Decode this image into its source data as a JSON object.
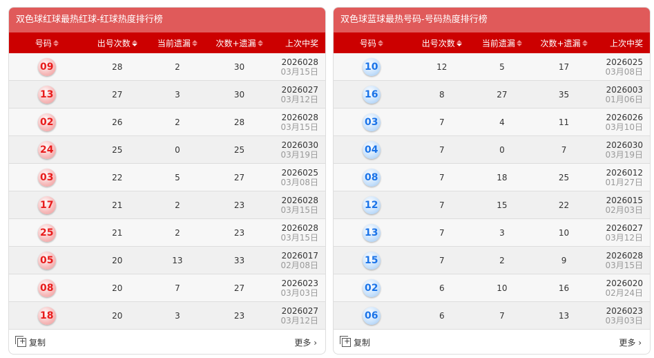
{
  "columns": [
    "号码",
    "出号次数",
    "当前遗漏",
    "次数+遗漏",
    "上次中奖"
  ],
  "footer": {
    "copy": "复制",
    "more": "更多 ›"
  },
  "panels": [
    {
      "title": "双色球红球最热红球-红球热度排行榜",
      "ball": "red",
      "rows": [
        [
          "09",
          "28",
          "2",
          "30",
          "2026028",
          "03月15日"
        ],
        [
          "13",
          "27",
          "3",
          "30",
          "2026027",
          "03月12日"
        ],
        [
          "02",
          "26",
          "2",
          "28",
          "2026028",
          "03月15日"
        ],
        [
          "24",
          "25",
          "0",
          "25",
          "2026030",
          "03月19日"
        ],
        [
          "03",
          "22",
          "5",
          "27",
          "2026025",
          "03月08日"
        ],
        [
          "17",
          "21",
          "2",
          "23",
          "2026028",
          "03月15日"
        ],
        [
          "25",
          "21",
          "2",
          "23",
          "2026028",
          "03月15日"
        ],
        [
          "05",
          "20",
          "13",
          "33",
          "2026017",
          "02月08日"
        ],
        [
          "08",
          "20",
          "7",
          "27",
          "2026023",
          "03月03日"
        ],
        [
          "18",
          "20",
          "3",
          "23",
          "2026027",
          "03月12日"
        ]
      ]
    },
    {
      "title": "双色球蓝球最热号码-号码热度排行榜",
      "ball": "blue",
      "rows": [
        [
          "10",
          "12",
          "5",
          "17",
          "2026025",
          "03月08日"
        ],
        [
          "16",
          "8",
          "27",
          "35",
          "2026003",
          "01月06日"
        ],
        [
          "03",
          "7",
          "4",
          "11",
          "2026026",
          "03月10日"
        ],
        [
          "04",
          "7",
          "0",
          "7",
          "2026030",
          "03月19日"
        ],
        [
          "08",
          "7",
          "18",
          "25",
          "2026012",
          "01月27日"
        ],
        [
          "12",
          "7",
          "15",
          "22",
          "2026015",
          "02月03日"
        ],
        [
          "13",
          "7",
          "3",
          "10",
          "2026027",
          "03月12日"
        ],
        [
          "15",
          "7",
          "2",
          "9",
          "2026028",
          "03月15日"
        ],
        [
          "02",
          "6",
          "10",
          "16",
          "2026020",
          "02月24日"
        ],
        [
          "06",
          "6",
          "7",
          "13",
          "2026023",
          "03月03日"
        ]
      ]
    }
  ]
}
